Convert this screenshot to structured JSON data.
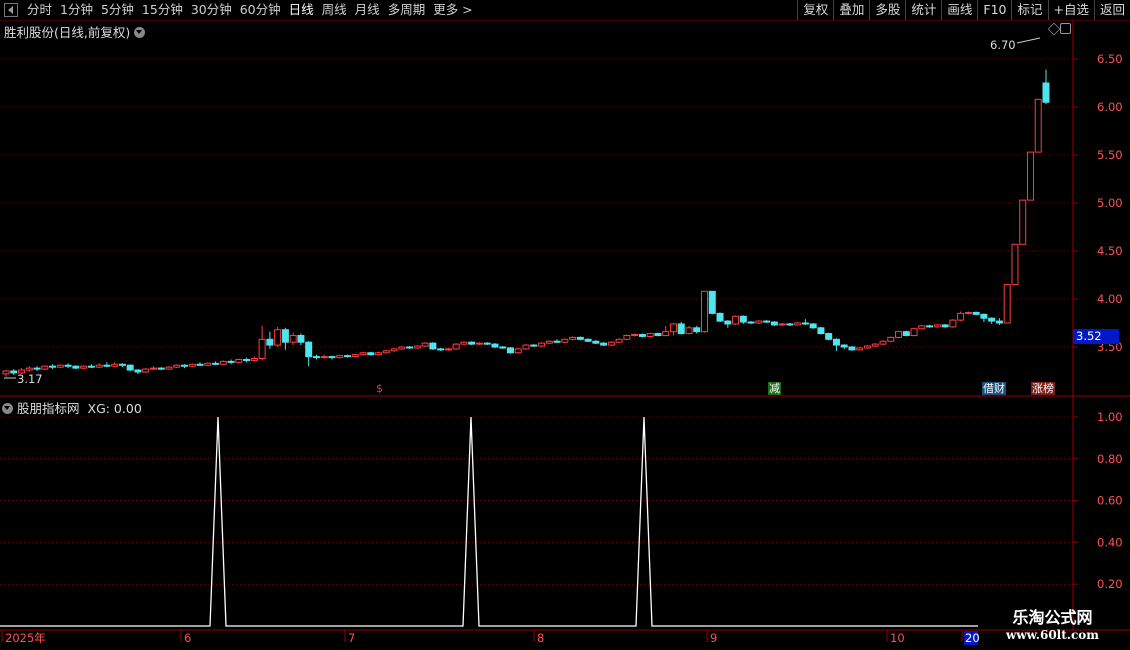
{
  "toolbar": {
    "periods": [
      "分时",
      "1分钟",
      "5分钟",
      "15分钟",
      "30分钟",
      "60分钟",
      "日线",
      "周线",
      "月线",
      "多周期",
      "更多 >"
    ],
    "active_period": "日线",
    "buttons": [
      "复权",
      "叠加",
      "多股",
      "统计",
      "画线",
      "F10",
      "标记",
      "+自选",
      "返回"
    ]
  },
  "main_pane": {
    "title": "胜利股份(日线,前复权)",
    "high_label": "6.70",
    "low_label": "3.17",
    "current_price": "3.52",
    "y_ticks": [
      "6.50",
      "6.00",
      "5.50",
      "5.00",
      "4.50",
      "4.00",
      "3.50"
    ],
    "markers": [
      {
        "text": "$",
        "color": "#ff3030",
        "bg": "none"
      },
      {
        "text": "减",
        "color": "#ffffff",
        "bg": "#1d6b1d"
      },
      {
        "text": "借财",
        "color": "#ffffff",
        "bg": "#1d4f7a"
      },
      {
        "text": "涨榜",
        "color": "#ffffff",
        "bg": "#7a1d1d"
      }
    ]
  },
  "indicator_pane": {
    "title": "股朋指标网",
    "value_label": "XG: 0.00",
    "y_ticks": [
      "1.00",
      "0.80",
      "0.60",
      "0.40",
      "0.20"
    ],
    "signal_values": [
      1,
      1,
      1
    ]
  },
  "x_axis": {
    "labels": [
      "2025年",
      "6",
      "7",
      "8",
      "9",
      "10",
      "20"
    ]
  },
  "watermark": {
    "line1": "乐淘公式网",
    "line2": "www.60lt.com"
  },
  "colors": {
    "up": "#ff3c3c",
    "down": "#4ee6ee",
    "grid": "#7a0000",
    "axis": "#9a0000",
    "signal": "#ffffff",
    "price_tag": "#0018c8"
  },
  "chart_data": {
    "type": "candlestick",
    "title": "胜利股份(日线,前复权)",
    "y_range": [
      3.1,
      6.9
    ],
    "candles": [
      [
        3.22,
        3.25,
        3.19,
        3.26
      ],
      [
        3.25,
        3.23,
        3.21,
        3.27
      ],
      [
        3.23,
        3.26,
        3.22,
        3.28
      ],
      [
        3.26,
        3.28,
        3.24,
        3.3
      ],
      [
        3.28,
        3.27,
        3.25,
        3.3
      ],
      [
        3.27,
        3.3,
        3.26,
        3.31
      ],
      [
        3.3,
        3.29,
        3.27,
        3.32
      ],
      [
        3.29,
        3.31,
        3.28,
        3.32
      ],
      [
        3.31,
        3.3,
        3.28,
        3.33
      ],
      [
        3.3,
        3.28,
        3.27,
        3.31
      ],
      [
        3.28,
        3.3,
        3.27,
        3.31
      ],
      [
        3.3,
        3.29,
        3.28,
        3.32
      ],
      [
        3.29,
        3.31,
        3.28,
        3.33
      ],
      [
        3.31,
        3.3,
        3.29,
        3.34
      ],
      [
        3.3,
        3.32,
        3.29,
        3.34
      ],
      [
        3.32,
        3.31,
        3.29,
        3.33
      ],
      [
        3.31,
        3.26,
        3.25,
        3.32
      ],
      [
        3.26,
        3.24,
        3.22,
        3.27
      ],
      [
        3.24,
        3.27,
        3.23,
        3.28
      ],
      [
        3.27,
        3.28,
        3.26,
        3.3
      ],
      [
        3.28,
        3.27,
        3.26,
        3.29
      ],
      [
        3.27,
        3.29,
        3.26,
        3.3
      ],
      [
        3.29,
        3.31,
        3.28,
        3.32
      ],
      [
        3.31,
        3.3,
        3.28,
        3.32
      ],
      [
        3.3,
        3.32,
        3.29,
        3.33
      ],
      [
        3.32,
        3.31,
        3.3,
        3.34
      ],
      [
        3.31,
        3.33,
        3.3,
        3.34
      ],
      [
        3.33,
        3.32,
        3.31,
        3.35
      ],
      [
        3.32,
        3.35,
        3.31,
        3.36
      ],
      [
        3.35,
        3.34,
        3.32,
        3.37
      ],
      [
        3.34,
        3.37,
        3.33,
        3.38
      ],
      [
        3.37,
        3.36,
        3.34,
        3.39
      ],
      [
        3.36,
        3.38,
        3.35,
        3.4
      ],
      [
        3.38,
        3.58,
        3.36,
        3.72
      ],
      [
        3.58,
        3.52,
        3.48,
        3.66
      ],
      [
        3.52,
        3.68,
        3.5,
        3.71
      ],
      [
        3.68,
        3.55,
        3.47,
        3.7
      ],
      [
        3.55,
        3.62,
        3.52,
        3.65
      ],
      [
        3.62,
        3.55,
        3.52,
        3.64
      ],
      [
        3.55,
        3.4,
        3.3,
        3.56
      ],
      [
        3.4,
        3.39,
        3.37,
        3.42
      ],
      [
        3.39,
        3.4,
        3.38,
        3.42
      ],
      [
        3.4,
        3.39,
        3.37,
        3.41
      ],
      [
        3.39,
        3.41,
        3.38,
        3.42
      ],
      [
        3.41,
        3.4,
        3.39,
        3.42
      ],
      [
        3.4,
        3.42,
        3.39,
        3.43
      ],
      [
        3.42,
        3.44,
        3.41,
        3.45
      ],
      [
        3.44,
        3.42,
        3.41,
        3.45
      ],
      [
        3.42,
        3.44,
        3.41,
        3.45
      ],
      [
        3.44,
        3.46,
        3.43,
        3.47
      ],
      [
        3.46,
        3.48,
        3.45,
        3.49
      ],
      [
        3.48,
        3.5,
        3.47,
        3.51
      ],
      [
        3.5,
        3.49,
        3.48,
        3.51
      ],
      [
        3.49,
        3.51,
        3.48,
        3.52
      ],
      [
        3.51,
        3.54,
        3.5,
        3.55
      ],
      [
        3.54,
        3.48,
        3.47,
        3.55
      ],
      [
        3.48,
        3.47,
        3.46,
        3.49
      ],
      [
        3.47,
        3.48,
        3.46,
        3.49
      ],
      [
        3.48,
        3.53,
        3.47,
        3.54
      ],
      [
        3.53,
        3.55,
        3.52,
        3.56
      ],
      [
        3.55,
        3.53,
        3.52,
        3.56
      ],
      [
        3.53,
        3.54,
        3.52,
        3.55
      ],
      [
        3.54,
        3.53,
        3.52,
        3.55
      ],
      [
        3.53,
        3.5,
        3.49,
        3.54
      ],
      [
        3.5,
        3.49,
        3.48,
        3.51
      ],
      [
        3.49,
        3.44,
        3.43,
        3.5
      ],
      [
        3.44,
        3.48,
        3.43,
        3.49
      ],
      [
        3.48,
        3.52,
        3.47,
        3.53
      ],
      [
        3.52,
        3.51,
        3.5,
        3.53
      ],
      [
        3.51,
        3.54,
        3.5,
        3.55
      ],
      [
        3.54,
        3.56,
        3.53,
        3.57
      ],
      [
        3.56,
        3.55,
        3.54,
        3.58
      ],
      [
        3.55,
        3.58,
        3.54,
        3.59
      ],
      [
        3.58,
        3.6,
        3.57,
        3.61
      ],
      [
        3.6,
        3.58,
        3.57,
        3.61
      ],
      [
        3.58,
        3.56,
        3.55,
        3.59
      ],
      [
        3.56,
        3.54,
        3.53,
        3.57
      ],
      [
        3.54,
        3.52,
        3.51,
        3.55
      ],
      [
        3.52,
        3.55,
        3.51,
        3.56
      ],
      [
        3.55,
        3.58,
        3.54,
        3.59
      ],
      [
        3.58,
        3.62,
        3.57,
        3.63
      ],
      [
        3.62,
        3.63,
        3.61,
        3.64
      ],
      [
        3.63,
        3.61,
        3.6,
        3.64
      ],
      [
        3.61,
        3.64,
        3.6,
        3.65
      ],
      [
        3.64,
        3.62,
        3.61,
        3.65
      ],
      [
        3.62,
        3.66,
        3.61,
        3.72
      ],
      [
        3.66,
        3.74,
        3.62,
        3.75
      ],
      [
        3.74,
        3.64,
        3.63,
        3.76
      ],
      [
        3.64,
        3.7,
        3.63,
        3.72
      ],
      [
        3.7,
        3.66,
        3.64,
        3.72
      ],
      [
        3.66,
        4.08,
        3.65,
        4.08
      ],
      [
        4.08,
        3.85,
        3.84,
        4.08
      ],
      [
        3.85,
        3.77,
        3.76,
        3.86
      ],
      [
        3.77,
        3.74,
        3.7,
        3.78
      ],
      [
        3.74,
        3.82,
        3.73,
        3.83
      ],
      [
        3.82,
        3.76,
        3.74,
        3.83
      ],
      [
        3.76,
        3.75,
        3.74,
        3.77
      ],
      [
        3.75,
        3.77,
        3.74,
        3.78
      ],
      [
        3.77,
        3.76,
        3.75,
        3.78
      ],
      [
        3.76,
        3.73,
        3.72,
        3.77
      ],
      [
        3.73,
        3.74,
        3.72,
        3.75
      ],
      [
        3.74,
        3.73,
        3.72,
        3.75
      ],
      [
        3.73,
        3.75,
        3.72,
        3.76
      ],
      [
        3.75,
        3.74,
        3.73,
        3.79
      ],
      [
        3.74,
        3.7,
        3.69,
        3.75
      ],
      [
        3.7,
        3.64,
        3.63,
        3.71
      ],
      [
        3.64,
        3.58,
        3.57,
        3.65
      ],
      [
        3.58,
        3.52,
        3.46,
        3.59
      ],
      [
        3.52,
        3.5,
        3.48,
        3.53
      ],
      [
        3.5,
        3.47,
        3.46,
        3.51
      ],
      [
        3.47,
        3.49,
        3.46,
        3.5
      ],
      [
        3.49,
        3.51,
        3.48,
        3.52
      ],
      [
        3.51,
        3.53,
        3.5,
        3.54
      ],
      [
        3.53,
        3.56,
        3.52,
        3.57
      ],
      [
        3.56,
        3.6,
        3.55,
        3.61
      ],
      [
        3.6,
        3.66,
        3.59,
        3.67
      ],
      [
        3.66,
        3.62,
        3.61,
        3.67
      ],
      [
        3.62,
        3.69,
        3.61,
        3.7
      ],
      [
        3.69,
        3.72,
        3.68,
        3.73
      ],
      [
        3.72,
        3.71,
        3.7,
        3.73
      ],
      [
        3.71,
        3.73,
        3.7,
        3.74
      ],
      [
        3.73,
        3.71,
        3.7,
        3.74
      ],
      [
        3.71,
        3.78,
        3.7,
        3.79
      ],
      [
        3.78,
        3.85,
        3.77,
        3.87
      ],
      [
        3.85,
        3.86,
        3.84,
        3.87
      ],
      [
        3.86,
        3.84,
        3.83,
        3.87
      ],
      [
        3.84,
        3.8,
        3.76,
        3.85
      ],
      [
        3.8,
        3.77,
        3.74,
        3.81
      ],
      [
        3.77,
        3.75,
        3.73,
        3.8
      ],
      [
        3.75,
        4.15,
        4.15,
        4.15
      ],
      [
        4.15,
        4.57,
        4.57,
        4.57
      ],
      [
        4.57,
        5.03,
        5.03,
        5.03
      ],
      [
        5.03,
        5.53,
        5.53,
        5.53
      ],
      [
        5.53,
        6.08,
        6.08,
        6.08
      ],
      [
        6.25,
        6.05,
        6.03,
        6.39
      ]
    ]
  }
}
